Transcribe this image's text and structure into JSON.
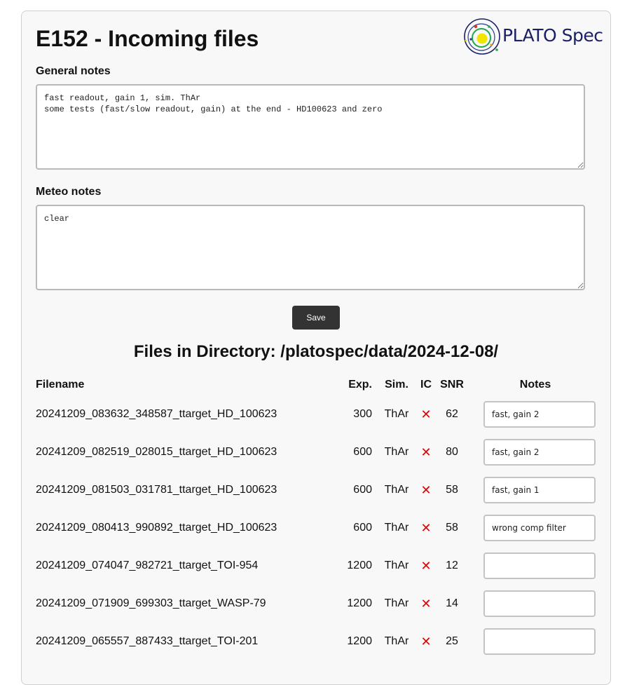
{
  "page": {
    "title": "E152 - Incoming files",
    "logo_text": "PLATO Spec"
  },
  "general_notes": {
    "label": "General notes",
    "value": "fast readout, gain 1, sim. ThAr\nsome tests (fast/slow readout, gain) at the end - HD100623 and zero"
  },
  "meteo_notes": {
    "label": "Meteo notes",
    "value": "clear"
  },
  "save_label": "Save",
  "files": {
    "heading": "Files in Directory: /platospec/data/2024-12-08/",
    "columns": [
      "Filename",
      "Exp.",
      "Sim.",
      "IC",
      "SNR",
      "Notes"
    ],
    "rows": [
      {
        "filename": "20241209_083632_348587_ttarget_HD_100623",
        "exp": "300",
        "sim": "ThAr",
        "ic": "✕",
        "snr": "62",
        "notes": "fast, gain 2"
      },
      {
        "filename": "20241209_082519_028015_ttarget_HD_100623",
        "exp": "600",
        "sim": "ThAr",
        "ic": "✕",
        "snr": "80",
        "notes": "fast, gain 2"
      },
      {
        "filename": "20241209_081503_031781_ttarget_HD_100623",
        "exp": "600",
        "sim": "ThAr",
        "ic": "✕",
        "snr": "58",
        "notes": "fast, gain 1"
      },
      {
        "filename": "20241209_080413_990892_ttarget_HD_100623",
        "exp": "600",
        "sim": "ThAr",
        "ic": "✕",
        "snr": "58",
        "notes": "wrong comp filter"
      },
      {
        "filename": "20241209_074047_982721_ttarget_TOI-954",
        "exp": "1200",
        "sim": "ThAr",
        "ic": "✕",
        "snr": "12",
        "notes": ""
      },
      {
        "filename": "20241209_071909_699303_ttarget_WASP-79",
        "exp": "1200",
        "sim": "ThAr",
        "ic": "✕",
        "snr": "14",
        "notes": ""
      },
      {
        "filename": "20241209_065557_887433_ttarget_TOI-201",
        "exp": "1200",
        "sim": "ThAr",
        "ic": "✕",
        "snr": "25",
        "notes": ""
      }
    ]
  },
  "colors": {
    "ic_cross": "#e10000",
    "save_button": "#333333",
    "logo_text": "#1b1f66"
  },
  "icons": {
    "logo": "plato-spec-logo",
    "ic_status": "cross-icon"
  }
}
